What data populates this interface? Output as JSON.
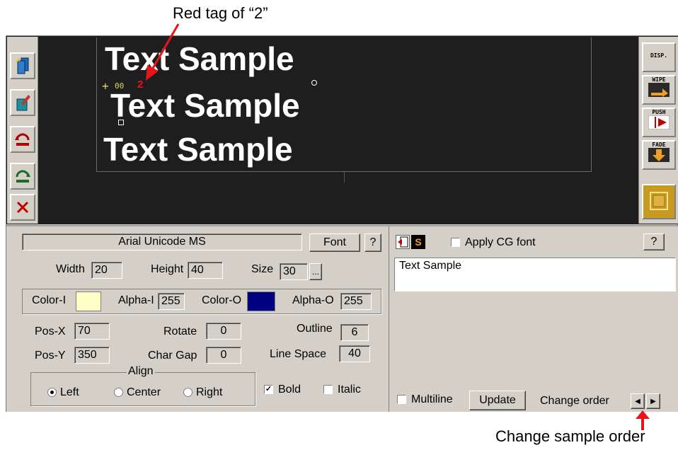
{
  "annotations": {
    "top": "Red tag of “2”",
    "bottom": "Change sample order",
    "arrow_color": "#e8141a"
  },
  "preview": {
    "samples": [
      "Text Sample",
      "Text Sample",
      "Text Sample"
    ],
    "tag_number": "2",
    "tag_id": "00",
    "tag_color": "#e8141a"
  },
  "right_toolbar": {
    "disp": "DISP.",
    "wipe": "WIPE",
    "push": "PUSH",
    "fade": "FADE"
  },
  "left_toolbar": {
    "icons": [
      "layers-icon",
      "edit-layer-icon",
      "rotate-left-icon",
      "rotate-right-icon",
      "delete-icon"
    ]
  },
  "font_panel": {
    "font_name": "Arial Unicode MS",
    "font_button": "Font",
    "help": "?",
    "width_label": "Width",
    "width": "20",
    "height_label": "Height",
    "height": "40",
    "size_label": "Size",
    "size": "30",
    "size_more": "...",
    "color_i_label": "Color-I",
    "color_i": "#ffffc8",
    "alpha_i_label": "Alpha-I",
    "alpha_i": "255",
    "color_o_label": "Color-O",
    "color_o": "#000080",
    "alpha_o_label": "Alpha-O",
    "alpha_o": "255",
    "posx_label": "Pos-X",
    "posx": "70",
    "posy_label": "Pos-Y",
    "posy": "350",
    "rotate_label": "Rotate",
    "rotate": "0",
    "chargap_label": "Char Gap",
    "chargap": "0",
    "outline_label": "Outline",
    "outline": "6",
    "linespace_label": "Line Space",
    "linespace": "40",
    "align_label": "Align",
    "align_left": "Left",
    "align_center": "Center",
    "align_right": "Right",
    "align_selected": "Left",
    "bold_label": "Bold",
    "bold": true,
    "italic_label": "Italic",
    "italic": false
  },
  "text_panel": {
    "apply_cg_font": "Apply CG font",
    "help": "?",
    "text": "Text Sample",
    "multiline": "Multiline",
    "update": "Update",
    "change_order": "Change order"
  }
}
